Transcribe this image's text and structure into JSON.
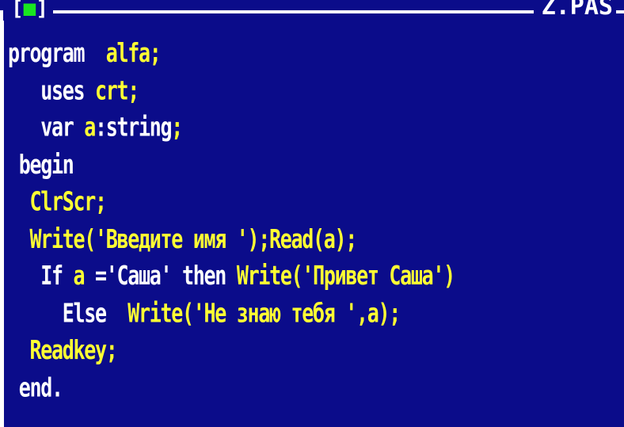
{
  "window": {
    "controls": "[■]",
    "file_name": "Z.PAS"
  },
  "code_lines": [
    [
      {
        "t": "program",
        "c": "kw"
      },
      {
        "t": "  ",
        "c": "kw"
      },
      {
        "t": "alfa;",
        "c": "id"
      }
    ],
    [
      {
        "t": "   uses ",
        "c": "kw"
      },
      {
        "t": "crt;",
        "c": "id"
      }
    ],
    [
      {
        "t": "   var ",
        "c": "kw"
      },
      {
        "t": "a",
        "c": "id"
      },
      {
        "t": ":string",
        "c": "kw"
      },
      {
        "t": ";",
        "c": "id"
      }
    ],
    [
      {
        "t": " begin",
        "c": "kw"
      }
    ],
    [
      {
        "t": "  ClrScr;",
        "c": "id"
      }
    ],
    [
      {
        "t": "  Write('Введите имя ');Read(a);",
        "c": "id"
      }
    ],
    [
      {
        "t": "   If ",
        "c": "kw"
      },
      {
        "t": "a ",
        "c": "id"
      },
      {
        "t": "='Саша' ",
        "c": "kw"
      },
      {
        "t": "then ",
        "c": "kw"
      },
      {
        "t": "Write('Привет Саша')",
        "c": "id"
      }
    ],
    [
      {
        "t": "     Else  ",
        "c": "kw"
      },
      {
        "t": "Write('Не знаю тебя ',a);",
        "c": "id"
      }
    ],
    [
      {
        "t": "  Readkey;",
        "c": "id"
      }
    ],
    [
      {
        "t": " end.",
        "c": "kw"
      }
    ]
  ],
  "colors": {
    "background": "#0b0c8a",
    "keyword": "#ffffff",
    "identifier": "#ffff33",
    "close_button": "#19e620"
  }
}
